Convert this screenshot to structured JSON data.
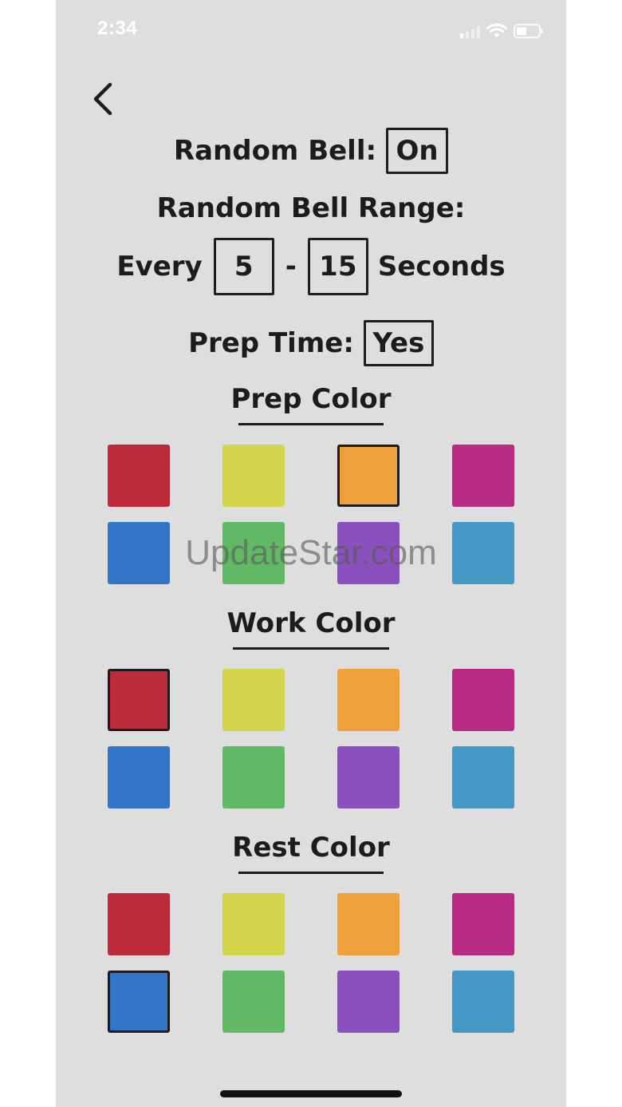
{
  "status_bar": {
    "time": "2:34"
  },
  "settings": {
    "random_bell_label": "Random Bell:",
    "random_bell_value": "On",
    "range_label": "Random Bell Range:",
    "every_label": "Every",
    "range_min": "5",
    "range_separator": "-",
    "range_max": "15",
    "seconds_label": "Seconds",
    "prep_time_label": "Prep Time:",
    "prep_time_value": "Yes"
  },
  "palette": [
    "#bd2a3a",
    "#d3d64a",
    "#f0a03a",
    "#b92a82",
    "#3375c6",
    "#61b966",
    "#8a50bd",
    "#4598c4"
  ],
  "sections": [
    {
      "title": "Prep Color",
      "selected_index": 2
    },
    {
      "title": "Work Color",
      "selected_index": 0
    },
    {
      "title": "Rest Color",
      "selected_index": 4
    }
  ],
  "watermark": "UpdateStar.com"
}
